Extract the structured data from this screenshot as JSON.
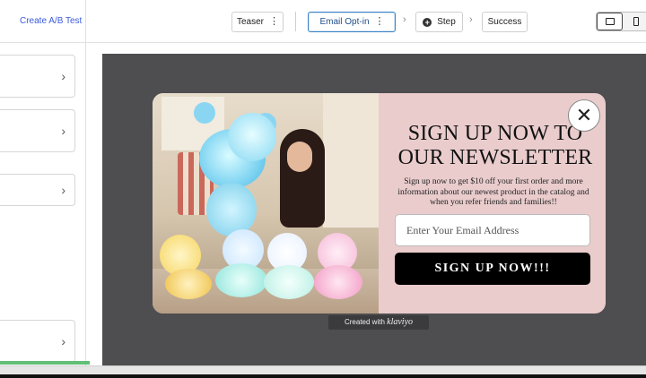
{
  "topbar": {
    "ab_test_label": "Create A/B Test",
    "steps": [
      {
        "label": "Teaser"
      },
      {
        "label": "Email Opt-in"
      },
      {
        "label": "Step"
      },
      {
        "label": "Success"
      }
    ],
    "device_toggle": {
      "selected": "desktop"
    }
  },
  "left_panel": {
    "chevron": "›"
  },
  "popup": {
    "headline": "SIGN UP NOW TO OUR NEWSLETTER",
    "subtext": "Sign up now to get $10 off your first order and more information about our newest product in the catalog and when you refer friends and families!!",
    "email_placeholder": "Enter Your Email Address",
    "cta_label": "SIGN UP NOW!!!",
    "close_glyph": "✕"
  },
  "credit": {
    "prefix": "Created with",
    "brand": "klaviyo"
  },
  "colors": {
    "popup_background": "#eacccd",
    "canvas_background": "#4e4e50",
    "cta_background": "#000000",
    "active_step_border": "#3b82c4"
  }
}
